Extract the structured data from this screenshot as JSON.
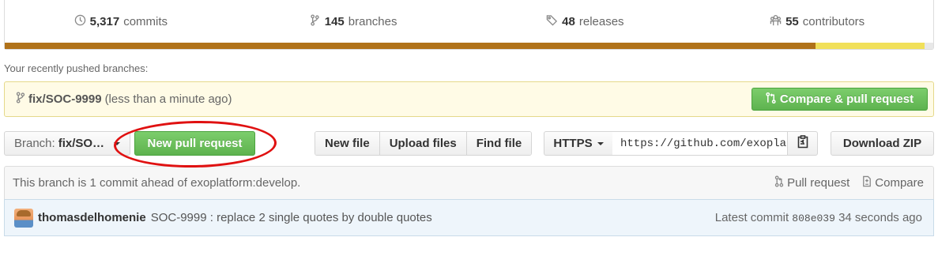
{
  "summary": {
    "commits_count": "5,317",
    "commits_label": "commits",
    "branches_count": "145",
    "branches_label": "branches",
    "releases_count": "48",
    "releases_label": "releases",
    "contributors_count": "55",
    "contributors_label": "contributors"
  },
  "language_bar": [
    {
      "color": "#b07219",
      "fraction": 0.873
    },
    {
      "color": "#f1e05a",
      "fraction": 0.118
    },
    {
      "color": "#e8e8e8",
      "fraction": 0.009
    }
  ],
  "recent": {
    "label": "Your recently pushed branches:",
    "branch_prefix": "fix/",
    "branch_name": "SOC-9999",
    "time": "(less than a minute ago)",
    "compare_button": "Compare & pull request"
  },
  "toolbar": {
    "branch_label": "Branch:",
    "branch_value": "fix/SO…",
    "new_pr_button": "New pull request",
    "new_file": "New file",
    "upload_files": "Upload files",
    "find_file": "Find file",
    "protocol": "HTTPS",
    "clone_url": "https://github.com/exoplatform/social.git",
    "download_zip": "Download ZIP"
  },
  "ahead": {
    "text": "This branch is 1 commit ahead of exoplatform:develop.",
    "pull_request": "Pull request",
    "compare": "Compare"
  },
  "commit": {
    "author": "thomasdelhomenie",
    "message": "SOC-9999 : replace 2 single quotes by double quotes",
    "latest_label": "Latest commit",
    "sha": "808e039",
    "time": "34 seconds ago"
  },
  "annotation_color": "#e01111"
}
